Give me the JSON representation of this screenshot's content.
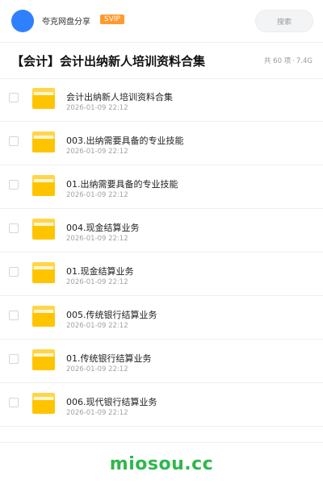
{
  "header": {
    "username": "夸克网盘分享",
    "badge": "SVIP",
    "search_placeholder": "搜索"
  },
  "share": {
    "title": "【会计】会计出纳新人培训资料合集",
    "item_count": "共 60 项",
    "separator": "·",
    "total_size": "7.4G"
  },
  "files": [
    {
      "name": "会计出纳新人培训资料合集",
      "date": "2026-01-09 22:12"
    },
    {
      "name": "003.出纳需要具备的专业技能",
      "date": "2026-01-09 22:12"
    },
    {
      "name": "01.出纳需要具备的专业技能",
      "date": "2026-01-09 22:12"
    },
    {
      "name": "004.现金结算业务",
      "date": "2026-01-09 22:12"
    },
    {
      "name": "01.现金结算业务",
      "date": "2026-01-09 22:12"
    },
    {
      "name": "005.传统银行结算业务",
      "date": "2026-01-09 22:12"
    },
    {
      "name": "01.传统银行结算业务",
      "date": "2026-01-09 22:12"
    },
    {
      "name": "006.现代银行结算业务",
      "date": "2026-01-09 22:12"
    }
  ],
  "footer": {
    "brand": "miosou.cc"
  },
  "colors": {
    "avatar": "#2f80ff",
    "badge": "#ff9a2e",
    "folder": "#ffc400",
    "brand": "#2db84c"
  },
  "icons": {
    "folder": "folder-icon",
    "checkbox": "checkbox"
  }
}
